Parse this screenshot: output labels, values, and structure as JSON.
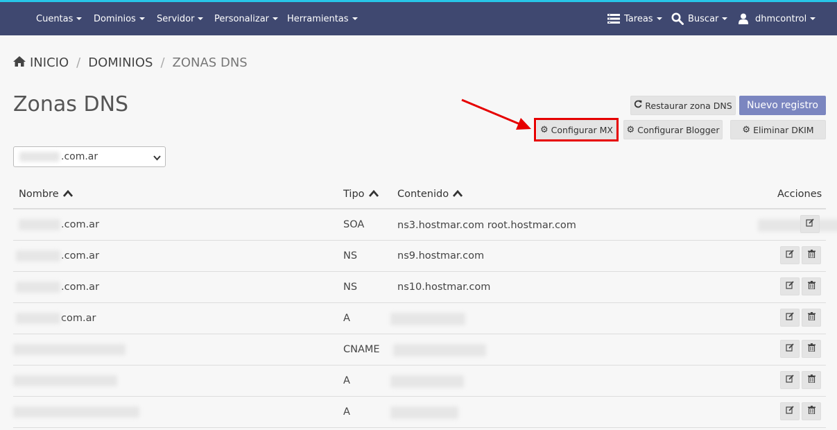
{
  "navbar": {
    "menu": [
      "Cuentas",
      "Dominios",
      "Servidor",
      "Personalizar",
      "Herramientas"
    ],
    "tasks_label": "Tareas",
    "search_label": "Buscar",
    "user_label": "dhmcontrol"
  },
  "breadcrumb": {
    "home": "INICIO",
    "section": "DOMINIOS",
    "current": "ZONAS DNS"
  },
  "page_title": "Zonas DNS",
  "buttons": {
    "restore": "Restaurar zona DNS",
    "new_record": "Nuevo registro",
    "config_mx": "Configurar MX",
    "config_blogger": "Configurar Blogger",
    "delete_dkim": "Eliminar DKIM"
  },
  "domain_select": {
    "value_suffix": ".com.ar"
  },
  "table": {
    "headers": {
      "name": "Nombre",
      "type": "Tipo",
      "content": "Contenido",
      "actions": "Acciones"
    },
    "rows": [
      {
        "name": ".com.ar",
        "type": "SOA",
        "content": "ns3.hostmar.com root.hostmar.com",
        "deletable": false
      },
      {
        "name": ".com.ar",
        "type": "NS",
        "content": "ns9.hostmar.com",
        "deletable": true
      },
      {
        "name": ".com.ar",
        "type": "NS",
        "content": "ns10.hostmar.com",
        "deletable": true
      },
      {
        "name": "com.ar",
        "type": "A",
        "content": "",
        "deletable": true
      },
      {
        "name": "",
        "type": "CNAME",
        "content": "",
        "deletable": true
      },
      {
        "name": "",
        "type": "A",
        "content": "",
        "deletable": true
      },
      {
        "name": "",
        "type": "A",
        "content": "",
        "deletable": true
      }
    ]
  },
  "colors": {
    "navbar": "#3f4870",
    "accent": "#27c6e8",
    "primary_button": "#7b86c0",
    "highlight": "#e60000"
  }
}
